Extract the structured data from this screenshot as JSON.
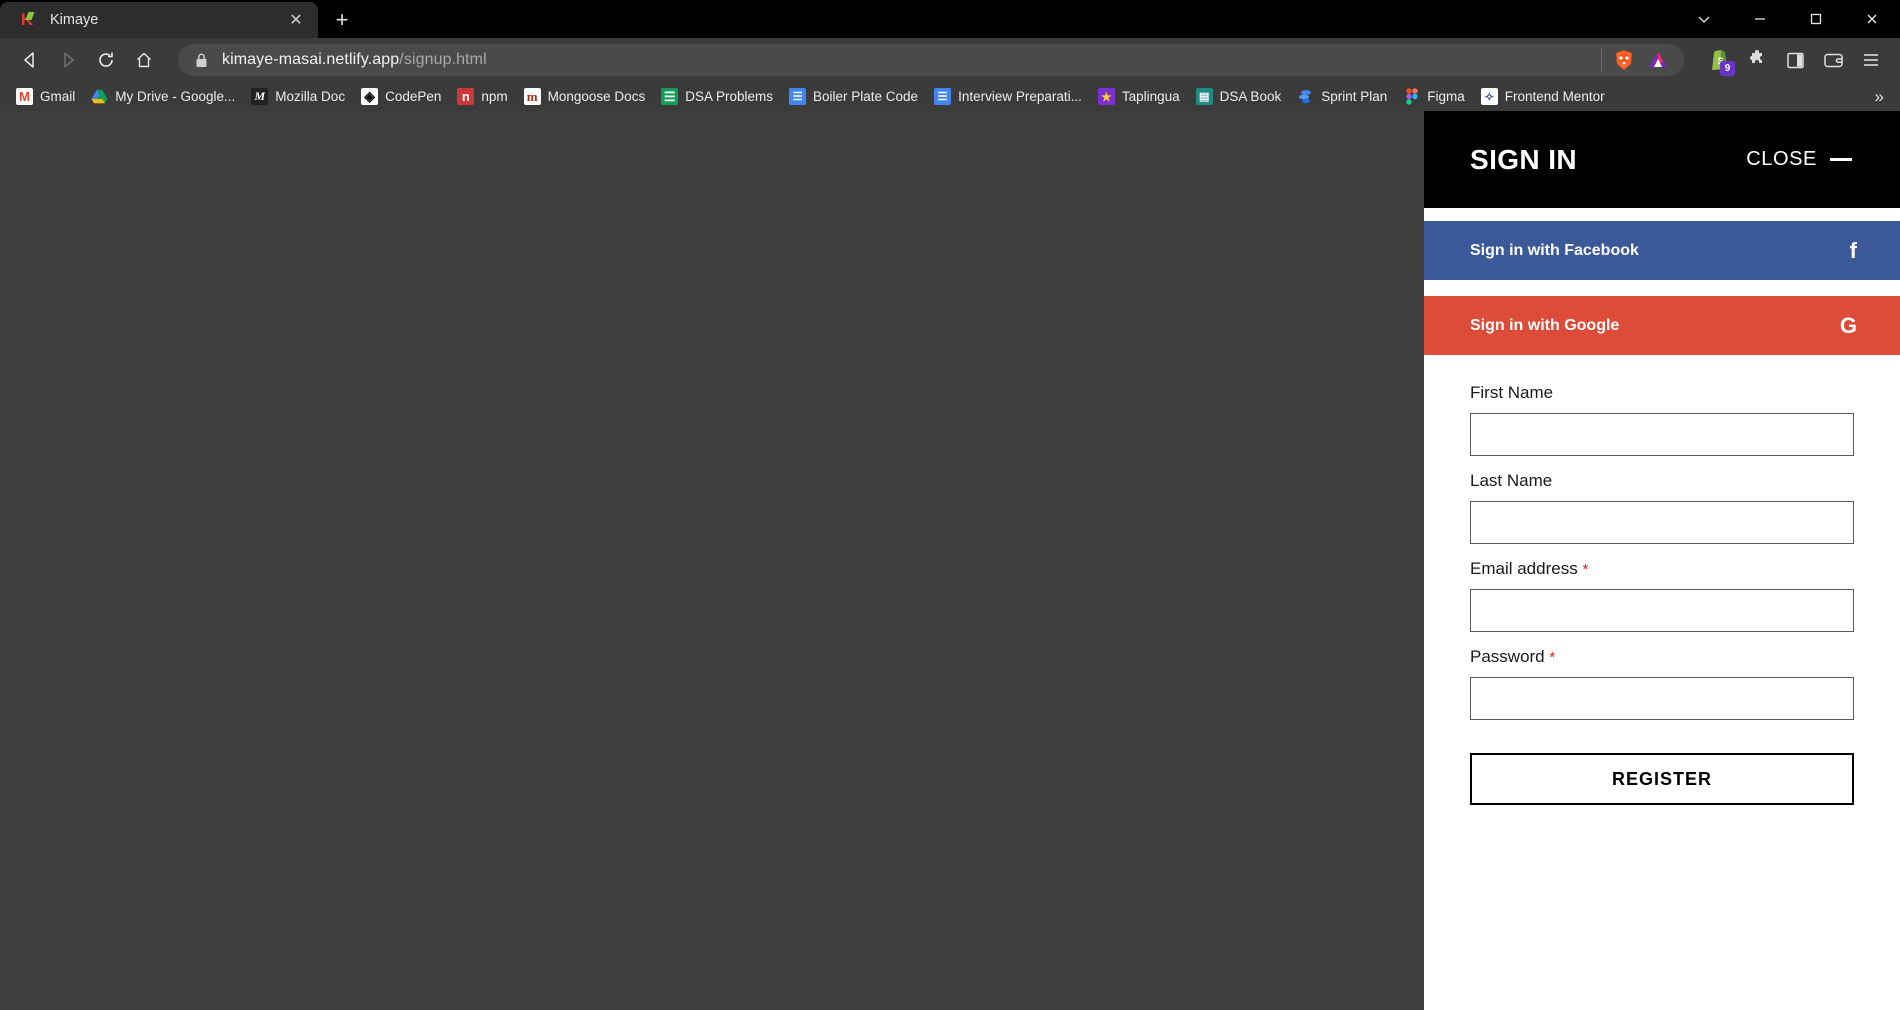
{
  "browser": {
    "tab": {
      "title": "Kimaye",
      "favicon": "kimaye-k-logo",
      "close_label": "✕"
    },
    "newtab_label": "+",
    "window_controls": {
      "tab_search": "chevron-down-icon",
      "minimize": "minimize-icon",
      "maximize": "maximize-icon",
      "close": "close-icon"
    },
    "nav": {
      "back": "◁",
      "forward": "▷",
      "reload": "↻",
      "home": "⌂",
      "bookmark": "bookmark-icon"
    },
    "address": {
      "security_icon": "lock-icon",
      "domain": "kimaye-masai.netlify.app",
      "path": "/signup.html",
      "shields_icon": "brave-lion-icon",
      "rewards_icon": "brave-rewards-triangle-icon"
    },
    "toolbar_icons": [
      {
        "name": "shopify-extension-icon",
        "badge": "9"
      },
      {
        "name": "extensions-puzzle-icon",
        "badge": ""
      },
      {
        "name": "sidebar-toggle-icon",
        "badge": ""
      },
      {
        "name": "wallet-icon",
        "badge": ""
      },
      {
        "name": "browser-menu-icon",
        "badge": ""
      }
    ],
    "bookmarks": [
      {
        "label": "Gmail",
        "icon": "gmail-icon",
        "glyph": "M",
        "cls": "ic-gmail"
      },
      {
        "label": "My Drive - Google...",
        "icon": "google-drive-icon",
        "glyph": "",
        "cls": "ic-drive"
      },
      {
        "label": "Mozilla Doc",
        "icon": "mdn-icon",
        "glyph": "M",
        "cls": "ic-mozilla"
      },
      {
        "label": "CodePen",
        "icon": "codepen-icon",
        "glyph": "◈",
        "cls": "ic-codepen"
      },
      {
        "label": "npm",
        "icon": "npm-icon",
        "glyph": "n",
        "cls": "ic-npm"
      },
      {
        "label": "Mongoose Docs",
        "icon": "mongoose-icon",
        "glyph": "m",
        "cls": "ic-mongoose"
      },
      {
        "label": "DSA Problems",
        "icon": "google-sheets-icon",
        "glyph": "☰",
        "cls": "ic-gsheets"
      },
      {
        "label": "Boiler Plate Code",
        "icon": "google-docs-icon",
        "glyph": "☰",
        "cls": "ic-gdocs"
      },
      {
        "label": "Interview Preparati...",
        "icon": "google-docs-icon",
        "glyph": "☰",
        "cls": "ic-gdocs"
      },
      {
        "label": "Taplingua",
        "icon": "taplingua-star-icon",
        "glyph": "★",
        "cls": "ic-taplingua"
      },
      {
        "label": "DSA Book",
        "icon": "dsa-book-icon",
        "glyph": "▤",
        "cls": "ic-dsabook"
      },
      {
        "label": "Sprint Plan",
        "icon": "sprint-plan-icon",
        "glyph": "≡",
        "cls": "ic-sprint"
      },
      {
        "label": "Figma",
        "icon": "figma-icon",
        "glyph": "",
        "cls": "ic-figma"
      },
      {
        "label": "Frontend Mentor",
        "icon": "frontend-mentor-icon",
        "glyph": "✧",
        "cls": "ic-fem"
      }
    ],
    "bookmarks_overflow": "»"
  },
  "page": {
    "overlay_color": "#3e3e3e",
    "panel": {
      "title": "SIGN IN",
      "close_label": "CLOSE",
      "social": [
        {
          "label": "Sign in with Facebook",
          "icon": "facebook-icon",
          "glyph": "f",
          "color": "#3b5998"
        },
        {
          "label": "Sign in with Google",
          "icon": "google-icon",
          "glyph": "G",
          "color": "#dd4b39"
        }
      ],
      "fields": [
        {
          "label": "First Name",
          "required": "",
          "value": "",
          "placeholder": "",
          "name": "first-name"
        },
        {
          "label": "Last Name",
          "required": "",
          "value": "",
          "placeholder": "",
          "name": "last-name"
        },
        {
          "label": "Email address",
          "required": "*",
          "value": "",
          "placeholder": "",
          "name": "email-address"
        },
        {
          "label": "Password",
          "required": "*",
          "value": "",
          "placeholder": "",
          "name": "password"
        }
      ],
      "submit_label": "REGISTER",
      "required_marker": "*",
      "required_color": "#e02020"
    }
  }
}
